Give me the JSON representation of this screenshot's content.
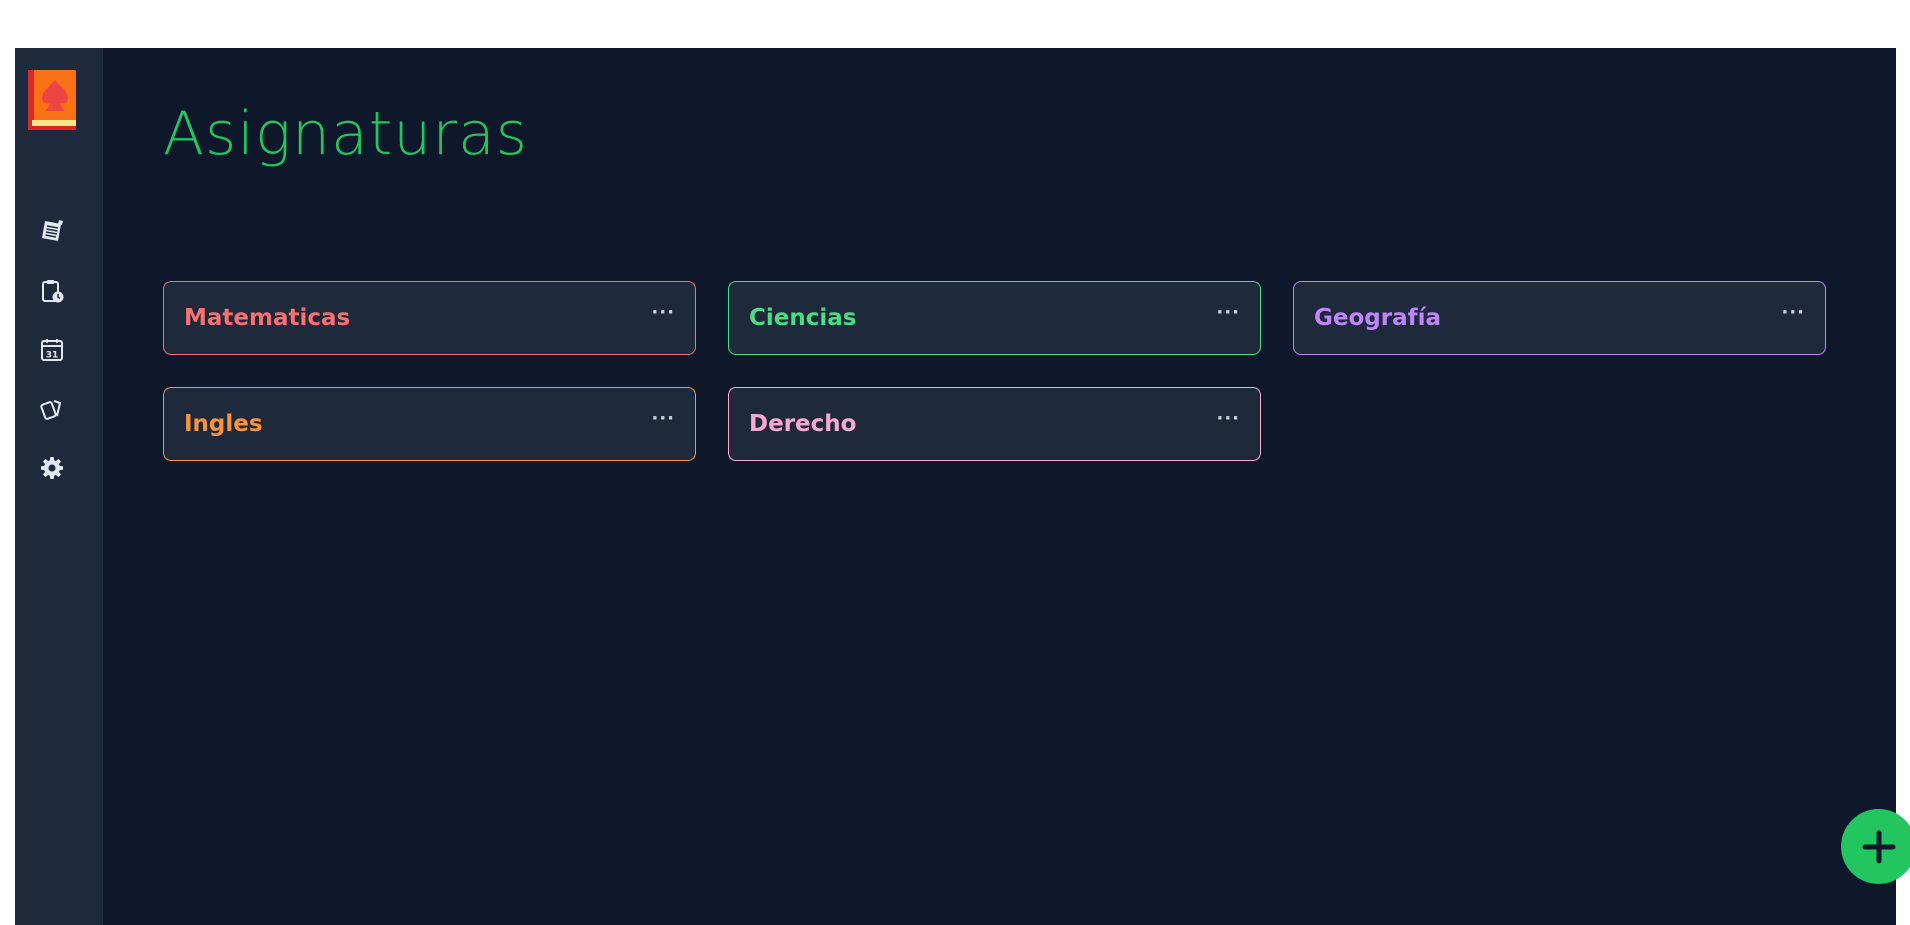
{
  "header": {
    "title": "Asignaturas"
  },
  "sidebar": {
    "items": [
      {
        "icon": "notes-icon"
      },
      {
        "icon": "clipboard-clock-icon"
      },
      {
        "icon": "calendar-31-icon"
      },
      {
        "icon": "flashcards-icon"
      },
      {
        "icon": "gear-icon"
      }
    ]
  },
  "subjects": [
    {
      "name": "Matematicas",
      "color": "#f87171",
      "menu": "···"
    },
    {
      "name": "Ciencias",
      "color": "#4ade80",
      "menu": "···"
    },
    {
      "name": "Geografía",
      "color": "#c084fc",
      "menu": "···"
    },
    {
      "name": "Ingles",
      "color": "#fb923c",
      "menu": "···"
    },
    {
      "name": "Derecho",
      "color": "#f9a8d4",
      "menu": "···"
    }
  ],
  "fab": {
    "icon": "plus-icon"
  }
}
